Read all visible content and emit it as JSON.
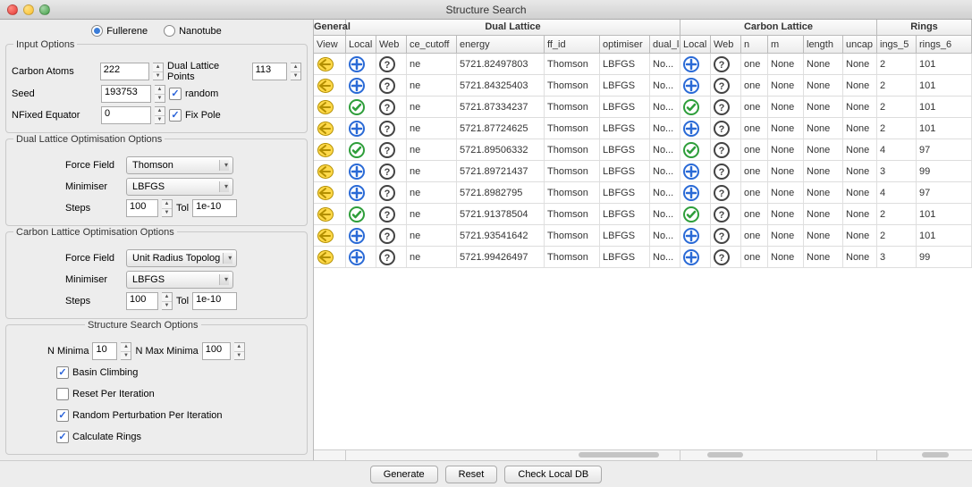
{
  "window": {
    "title": "Structure Search"
  },
  "struct_type": {
    "fullerene": "Fullerene",
    "nanotube": "Nanotube",
    "selected": "fullerene"
  },
  "input": {
    "title": "Input Options",
    "carbon_label": "Carbon Atoms",
    "carbon_value": "222",
    "dual_points_label": "Dual Lattice Points",
    "dual_points_value": "113",
    "seed_label": "Seed",
    "seed_value": "193753",
    "random_label": "random",
    "random_checked": true,
    "nfixed_label": "NFixed Equator",
    "nfixed_value": "0",
    "fixpole_label": "Fix Pole",
    "fixpole_checked": true
  },
  "dual_opt": {
    "title": "Dual Lattice Optimisation Options",
    "ff_label": "Force Field",
    "ff_value": "Thomson",
    "min_label": "Minimiser",
    "min_value": "LBFGS",
    "steps_label": "Steps",
    "steps_value": "100",
    "tol_label": "Tol",
    "tol_value": "1e-10"
  },
  "carbon_opt": {
    "title": "Carbon Lattice Optimisation Options",
    "ff_label": "Force Field",
    "ff_value": "Unit Radius Topolog",
    "min_label": "Minimiser",
    "min_value": "LBFGS",
    "steps_label": "Steps",
    "steps_value": "100",
    "tol_label": "Tol",
    "tol_value": "1e-10"
  },
  "search": {
    "title": "Structure Search Options",
    "nmin_label": "N Minima",
    "nmin_value": "10",
    "nmax_label": "N Max Minima",
    "nmax_value": "100",
    "basin": "Basin Climbing",
    "basin_checked": true,
    "reset": "Reset Per Iteration",
    "reset_checked": false,
    "random_perturb": "Random Perturbation Per Iteration",
    "random_perturb_checked": true,
    "calc_rings": "Calculate Rings",
    "calc_rings_checked": true
  },
  "table": {
    "groups": {
      "general": "General",
      "dual": "Dual Lattice",
      "carbon": "Carbon Lattice",
      "rings": "Rings"
    },
    "cols": {
      "view": "View",
      "local": "Local",
      "web": "Web",
      "cutoff": "ce_cutoff",
      "energy": "energy",
      "ffid": "ff_id",
      "optimiser": "optimiser",
      "dual_l": "dual_la",
      "local2": "Local",
      "web2": "Web",
      "n": "n",
      "m": "m",
      "length": "length",
      "unc": "uncap",
      "r5": "ings_5",
      "r6": "rings_6"
    },
    "rows": [
      {
        "local": "add",
        "web": "q",
        "cutoff": "ne",
        "energy": "5721.82497803",
        "ffid": "Thomson",
        "opt": "LBFGS",
        "dual": "No...",
        "local2": "add",
        "web2": "q",
        "n": "one",
        "m": "None",
        "len": "None",
        "unc": "None",
        "r5": "2",
        "r6": "101"
      },
      {
        "local": "add",
        "web": "q",
        "cutoff": "ne",
        "energy": "5721.84325403",
        "ffid": "Thomson",
        "opt": "LBFGS",
        "dual": "No...",
        "local2": "add",
        "web2": "q",
        "n": "one",
        "m": "None",
        "len": "None",
        "unc": "None",
        "r5": "2",
        "r6": "101"
      },
      {
        "local": "ok",
        "web": "q",
        "cutoff": "ne",
        "energy": "5721.87334237",
        "ffid": "Thomson",
        "opt": "LBFGS",
        "dual": "No...",
        "local2": "ok",
        "web2": "q",
        "n": "one",
        "m": "None",
        "len": "None",
        "unc": "None",
        "r5": "2",
        "r6": "101"
      },
      {
        "local": "add",
        "web": "q",
        "cutoff": "ne",
        "energy": "5721.87724625",
        "ffid": "Thomson",
        "opt": "LBFGS",
        "dual": "No...",
        "local2": "add",
        "web2": "q",
        "n": "one",
        "m": "None",
        "len": "None",
        "unc": "None",
        "r5": "2",
        "r6": "101"
      },
      {
        "local": "ok",
        "web": "q",
        "cutoff": "ne",
        "energy": "5721.89506332",
        "ffid": "Thomson",
        "opt": "LBFGS",
        "dual": "No...",
        "local2": "ok",
        "web2": "q",
        "n": "one",
        "m": "None",
        "len": "None",
        "unc": "None",
        "r5": "4",
        "r6": "97"
      },
      {
        "local": "add",
        "web": "q",
        "cutoff": "ne",
        "energy": "5721.89721437",
        "ffid": "Thomson",
        "opt": "LBFGS",
        "dual": "No...",
        "local2": "add",
        "web2": "q",
        "n": "one",
        "m": "None",
        "len": "None",
        "unc": "None",
        "r5": "3",
        "r6": "99"
      },
      {
        "local": "add",
        "web": "q",
        "cutoff": "ne",
        "energy": "5721.8982795",
        "ffid": "Thomson",
        "opt": "LBFGS",
        "dual": "No...",
        "local2": "add",
        "web2": "q",
        "n": "one",
        "m": "None",
        "len": "None",
        "unc": "None",
        "r5": "4",
        "r6": "97"
      },
      {
        "local": "ok",
        "web": "q",
        "cutoff": "ne",
        "energy": "5721.91378504",
        "ffid": "Thomson",
        "opt": "LBFGS",
        "dual": "No...",
        "local2": "ok",
        "web2": "q",
        "n": "one",
        "m": "None",
        "len": "None",
        "unc": "None",
        "r5": "2",
        "r6": "101"
      },
      {
        "local": "add",
        "web": "q",
        "cutoff": "ne",
        "energy": "5721.93541642",
        "ffid": "Thomson",
        "opt": "LBFGS",
        "dual": "No...",
        "local2": "add",
        "web2": "q",
        "n": "one",
        "m": "None",
        "len": "None",
        "unc": "None",
        "r5": "2",
        "r6": "101"
      },
      {
        "local": "add",
        "web": "q",
        "cutoff": "ne",
        "energy": "5721.99426497",
        "ffid": "Thomson",
        "opt": "LBFGS",
        "dual": "No...",
        "local2": "add",
        "web2": "q",
        "n": "one",
        "m": "None",
        "len": "None",
        "unc": "None",
        "r5": "3",
        "r6": "99"
      }
    ]
  },
  "buttons": {
    "generate": "Generate",
    "reset": "Reset",
    "check": "Check Local DB"
  },
  "icons": {
    "view": "view-icon",
    "add": "plus-circle-icon",
    "ok": "check-circle-icon",
    "q": "question-circle-icon"
  }
}
